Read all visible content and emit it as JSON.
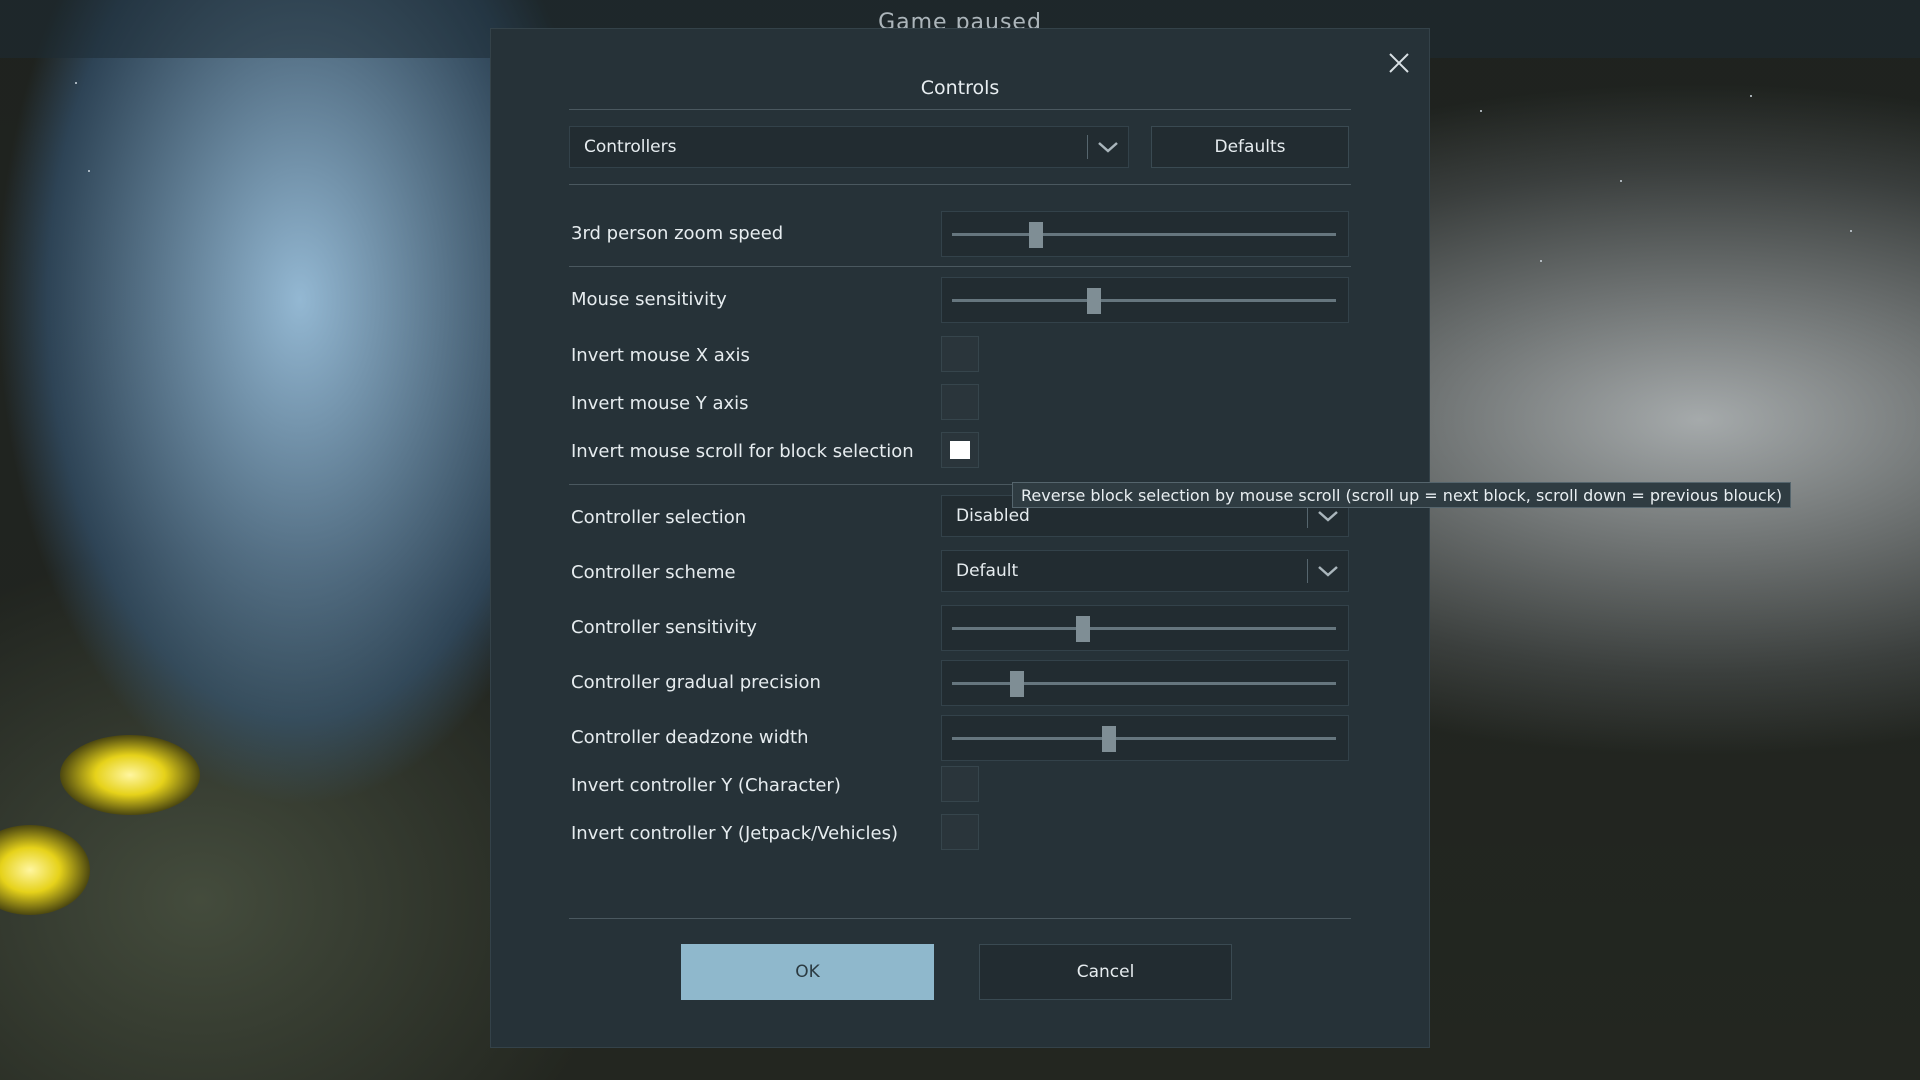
{
  "background": {
    "paused_text": "Game paused"
  },
  "dialog": {
    "title": "Controls",
    "close_icon": "close-icon",
    "category_combo": {
      "value": "Controllers"
    },
    "defaults_label": "Defaults",
    "rows": {
      "zoom_speed": {
        "label": "3rd person zoom speed",
        "value": 0.22
      },
      "mouse_sensitivity": {
        "label": "Mouse sensitivity",
        "value": 0.37
      },
      "invert_x": {
        "label": "Invert mouse X axis",
        "checked": false
      },
      "invert_y": {
        "label": "Invert mouse Y axis",
        "checked": false
      },
      "invert_scroll": {
        "label": "Invert mouse scroll for block selection",
        "checked": true
      },
      "controller_selection": {
        "label": "Controller selection",
        "value": "Disabled"
      },
      "controller_scheme": {
        "label": "Controller scheme",
        "value": "Default"
      },
      "controller_sensitivity": {
        "label": "Controller sensitivity",
        "value": 0.34
      },
      "gradual_precision": {
        "label": "Controller gradual precision",
        "value": 0.17
      },
      "deadzone_width": {
        "label": "Controller deadzone width",
        "value": 0.41
      },
      "invert_ctrl_char": {
        "label": "Invert controller Y (Character)",
        "checked": false
      },
      "invert_ctrl_vehicle": {
        "label": "Invert controller Y (Jetpack/Vehicles)",
        "checked": false
      }
    },
    "tooltip": "Reverse block selection by mouse scroll (scroll up = next block, scroll down = previous blouck)",
    "ok_label": "OK",
    "cancel_label": "Cancel",
    "colors": {
      "dialog_bg": "#263238",
      "ok_bg": "#8fb8cc",
      "accent_text": "#e6ecef"
    }
  }
}
